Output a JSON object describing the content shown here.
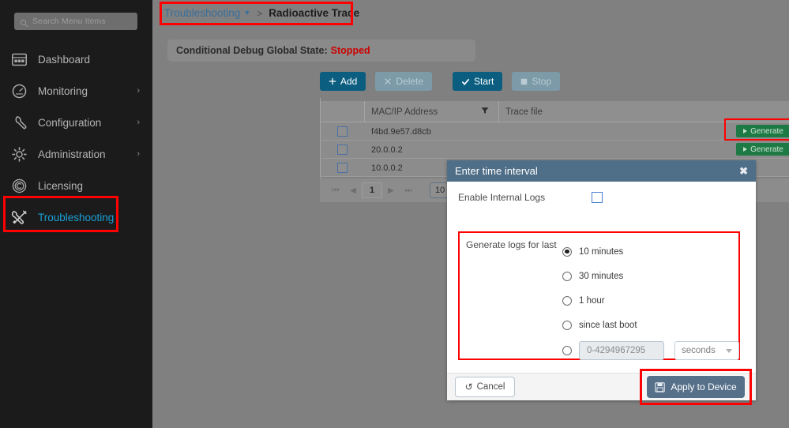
{
  "sidebar": {
    "search": {
      "placeholder": "Search Menu Items",
      "icon": "search-icon"
    },
    "items": [
      {
        "label": "Dashboard",
        "icon": "dashboard-icon",
        "chevron": "",
        "active": false
      },
      {
        "label": "Monitoring",
        "icon": "gauge-icon",
        "chevron": "›",
        "active": false
      },
      {
        "label": "Configuration",
        "icon": "wrench-icon",
        "chevron": "›",
        "active": false
      },
      {
        "label": "Administration",
        "icon": "gear-icon",
        "chevron": "›",
        "active": false
      },
      {
        "label": "Licensing",
        "icon": "copyright-icon",
        "chevron": "",
        "active": false
      },
      {
        "label": "Troubleshooting",
        "icon": "wrench-screwdriver-icon",
        "chevron": "",
        "active": true
      }
    ]
  },
  "breadcrumb": {
    "parent": "Troubleshooting",
    "separator": ">",
    "current": "Radioactive Trace"
  },
  "status": {
    "label": "Conditional Debug Global State:",
    "value": "Stopped",
    "value_color": "#cc0000"
  },
  "toolbar": {
    "add_label": "Add",
    "delete_label": "Delete",
    "start_label": "Start",
    "stop_label": "Stop"
  },
  "table": {
    "columns": [
      "",
      "MAC/IP Address",
      "Trace file",
      ""
    ],
    "rows": [
      {
        "mac": "f4bd.9e57.d8cb",
        "trace": "",
        "action": "Generate"
      },
      {
        "mac": "20.0.0.2",
        "trace": "",
        "action": "Generate"
      },
      {
        "mac": "10.0.0.2",
        "trace": "",
        "action": ""
      }
    ]
  },
  "pagination": {
    "first": "⏮",
    "prev": "◀",
    "page": "1",
    "next": "▶",
    "last": "⏭",
    "page_size": "10"
  },
  "modal": {
    "title": "Enter time interval",
    "close": "✖",
    "enable_logs_label": "Enable Internal Logs",
    "enable_logs_checked": false,
    "generate_label": "Generate logs for last",
    "options": [
      {
        "label": "10 minutes",
        "selected": true
      },
      {
        "label": "30 minutes",
        "selected": false
      },
      {
        "label": "1 hour",
        "selected": false
      },
      {
        "label": "since last boot",
        "selected": false
      }
    ],
    "custom": {
      "selected": false,
      "input_placeholder": "0-4294967295",
      "unit": "seconds"
    },
    "cancel_label": "Cancel",
    "apply_label": "Apply to Device"
  },
  "colors": {
    "accent_blue": "#0b5e80",
    "link_blue": "#3a6f9a",
    "sidebar_bg": "#1b1b1b",
    "page_bg": "#808080",
    "green_button": "#1e7a44",
    "modal_header": "#4f6e87",
    "apply_button": "#56708a",
    "highlight_red": "#ff0000",
    "status_red": "#cc0000",
    "active_item": "#1ba0d7"
  }
}
